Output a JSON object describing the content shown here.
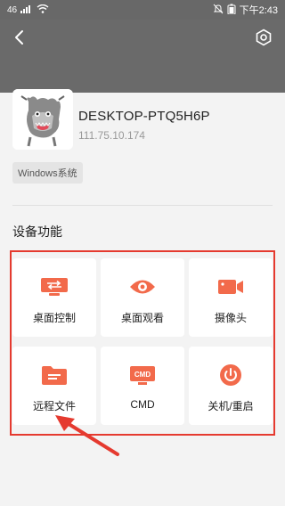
{
  "status_bar": {
    "carrier": "46",
    "time": "下午2:43"
  },
  "device": {
    "name": "DESKTOP-PTQ5H6P",
    "ip": "111.75.10.174",
    "os_tag": "Windows系统"
  },
  "section": {
    "title": "设备功能"
  },
  "functions": [
    {
      "label": "桌面控制",
      "icon": "remote-desktop-icon"
    },
    {
      "label": "桌面观看",
      "icon": "eye-icon"
    },
    {
      "label": "摄像头",
      "icon": "camera-icon"
    },
    {
      "label": "远程文件",
      "icon": "folder-icon"
    },
    {
      "label": "CMD",
      "icon": "cmd-icon"
    },
    {
      "label": "关机/重启",
      "icon": "power-icon"
    }
  ],
  "colors": {
    "accent": "#f26a4b",
    "highlight_border": "#e53a2f",
    "header": "#6a6a6a"
  }
}
